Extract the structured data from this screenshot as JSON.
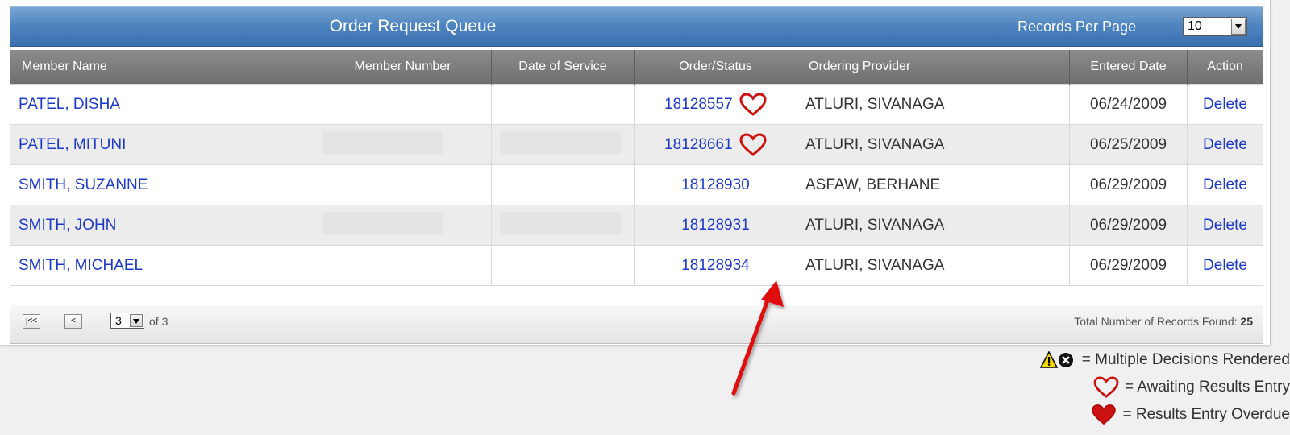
{
  "header": {
    "title": "Order Request Queue",
    "records_per_page_label": "Records Per Page",
    "records_per_page_value": "10"
  },
  "table": {
    "columns": [
      "Member Name",
      "Member Number",
      "Date of Service",
      "Order/Status",
      "Ordering Provider",
      "Entered Date",
      "Action"
    ],
    "rows": [
      {
        "member_name": "PATEL, DISHA",
        "order": "18128557",
        "status_icon": "heart-outline-icon",
        "provider": "ATLURI, SIVANAGA",
        "entered_date": "06/24/2009",
        "action": "Delete"
      },
      {
        "member_name": "PATEL, MITUNI",
        "order": "18128661",
        "status_icon": "heart-outline-icon",
        "provider": "ATLURI, SIVANAGA",
        "entered_date": "06/25/2009",
        "action": "Delete"
      },
      {
        "member_name": "SMITH, SUZANNE",
        "order": "18128930",
        "status_icon": "",
        "provider": "ASFAW, BERHANE",
        "entered_date": "06/29/2009",
        "action": "Delete"
      },
      {
        "member_name": "SMITH, JOHN",
        "order": "18128931",
        "status_icon": "",
        "provider": "ATLURI, SIVANAGA",
        "entered_date": "06/29/2009",
        "action": "Delete"
      },
      {
        "member_name": "SMITH, MICHAEL",
        "order": "18128934",
        "status_icon": "",
        "provider": "ATLURI, SIVANAGA",
        "entered_date": "06/29/2009",
        "action": "Delete"
      }
    ]
  },
  "pager": {
    "first_label": "|<<",
    "prev_label": "<",
    "current_page": "3",
    "of_label": "of 3",
    "total_label": "Total Number of Records Found:",
    "total_value": "25"
  },
  "legend": {
    "multiple_decisions": "= Multiple Decisions Rendered",
    "awaiting_results": "= Awaiting Results Entry",
    "results_overdue": "= Results Entry Overdue"
  },
  "colors": {
    "link": "#1e3ac8",
    "header_blue": "#4f86c1",
    "column_header_gray": "#7d7d7d",
    "heart_red": "#cc1111",
    "arrow_red": "#e01010"
  }
}
